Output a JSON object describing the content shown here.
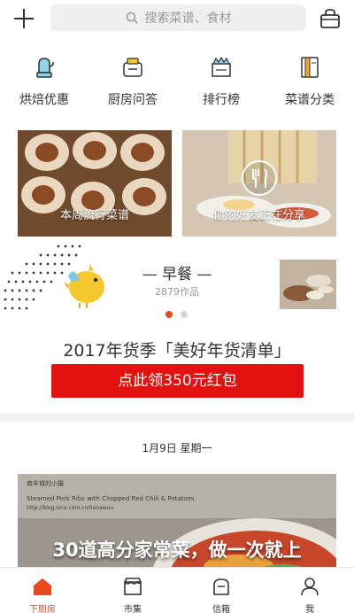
{
  "top_bar": {
    "search_placeholder": "搜索菜谱、食材",
    "icons": [
      "plus-icon",
      "search-icon",
      "basket-icon"
    ]
  },
  "categories": [
    {
      "label": "烘焙优惠",
      "icon": "mitten-icon"
    },
    {
      "label": "厨房问答",
      "icon": "toaster-icon"
    },
    {
      "label": "排行榜",
      "icon": "crown-box-icon"
    },
    {
      "label": "菜谱分类",
      "icon": "recipe-book-icon"
    }
  ],
  "cards": [
    {
      "title": "本周流行菜谱"
    },
    {
      "title": "你的好友正在分享"
    }
  ],
  "meal": {
    "title": "— 早餐 —",
    "count": "2879作品"
  },
  "promo": {
    "title": "2017年货季「美好年货清单」",
    "button": "点此领350元红包"
  },
  "feed": {
    "date": "1月9日 星期一",
    "item": {
      "overlay_text": "南丰城的小猫",
      "photo_caption": "Steamed Pork Ribs with Chopped Red Chili & Potatoes",
      "photo_url_text": "http://blog.sina.com.cn/lionawuu",
      "headline": "30道高分家常菜，做一次就上"
    }
  },
  "tab_bar": [
    {
      "label": "下厨房",
      "icon": "house-icon",
      "active": true
    },
    {
      "label": "市集",
      "icon": "market-icon",
      "active": false
    },
    {
      "label": "信箱",
      "icon": "mailbox-icon",
      "active": false
    },
    {
      "label": "",
      "icon": "",
      "active": false
    },
    {
      "label": "我",
      "icon": "person-icon",
      "active": false
    }
  ],
  "colors": {
    "accent": "#e8481c",
    "promo_red": "#e3110f",
    "chick_yellow": "#f5c82d"
  }
}
